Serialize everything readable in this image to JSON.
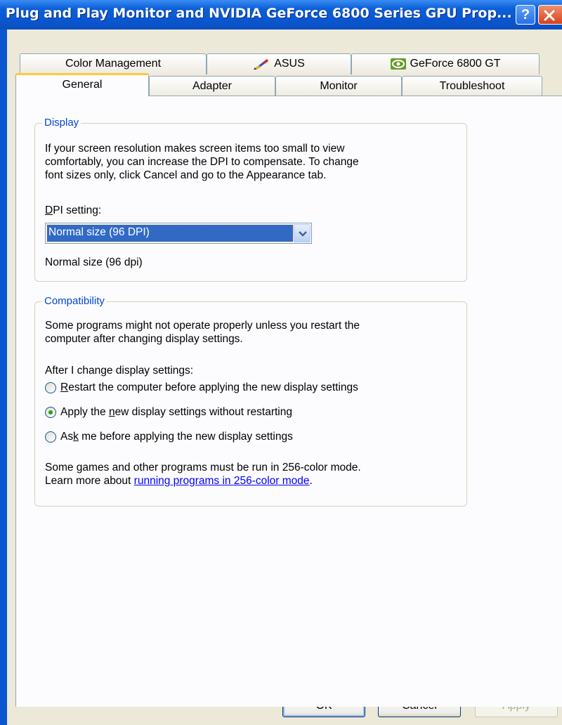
{
  "window": {
    "title": "Plug and Play Monitor and NVIDIA GeForce 6800 Series GPU Prop...",
    "help_label": "?"
  },
  "tabs": {
    "row1": [
      {
        "label": "Color Management",
        "icon": ""
      },
      {
        "label": "ASUS",
        "icon": "asus-pen-icon"
      },
      {
        "label": "GeForce 6800 GT",
        "icon": "nvidia-eye-icon"
      }
    ],
    "row2": [
      {
        "label": "General",
        "active": true
      },
      {
        "label": "Adapter"
      },
      {
        "label": "Monitor"
      },
      {
        "label": "Troubleshoot"
      }
    ]
  },
  "display": {
    "legend": "Display",
    "desc_line1": "If your screen resolution makes screen items too small to view",
    "desc_line2": "comfortably, you can increase the DPI to compensate.  To change",
    "desc_line3": "font sizes only, click Cancel and go to the Appearance tab.",
    "dpi_label_first": "D",
    "dpi_label_rest": "PI setting:",
    "dpi_selected": "Normal size (96 DPI)",
    "dpi_readout": "Normal size (96 dpi)"
  },
  "compatibility": {
    "legend": "Compatibility",
    "desc_line1": "Some programs might not operate properly unless you restart the",
    "desc_line2": "computer after changing display settings.",
    "after_label": "After I change display settings:",
    "options": [
      {
        "pre": "",
        "key": "R",
        "post": "estart the computer before applying the new display settings",
        "selected": false
      },
      {
        "pre": "Apply the ",
        "key": "n",
        "post": "ew display settings without restarting",
        "selected": true
      },
      {
        "pre": "As",
        "key": "k",
        "post": " me before applying the new display settings",
        "selected": false
      }
    ],
    "note_line1": "Some games and other programs must be run in 256-color mode.",
    "note_line2_prefix": "Learn more about ",
    "note_link": "running programs in 256-color mode",
    "note_line2_suffix": "."
  },
  "buttons": {
    "ok": "OK",
    "cancel": "Cancel",
    "apply": "Apply"
  },
  "colors": {
    "titlebar": "#0b5fd7",
    "legend_text": "#0046d5",
    "selection": "#316ac5",
    "radio_dot": "#21a121",
    "active_tab_accent": "#ffc83c"
  }
}
